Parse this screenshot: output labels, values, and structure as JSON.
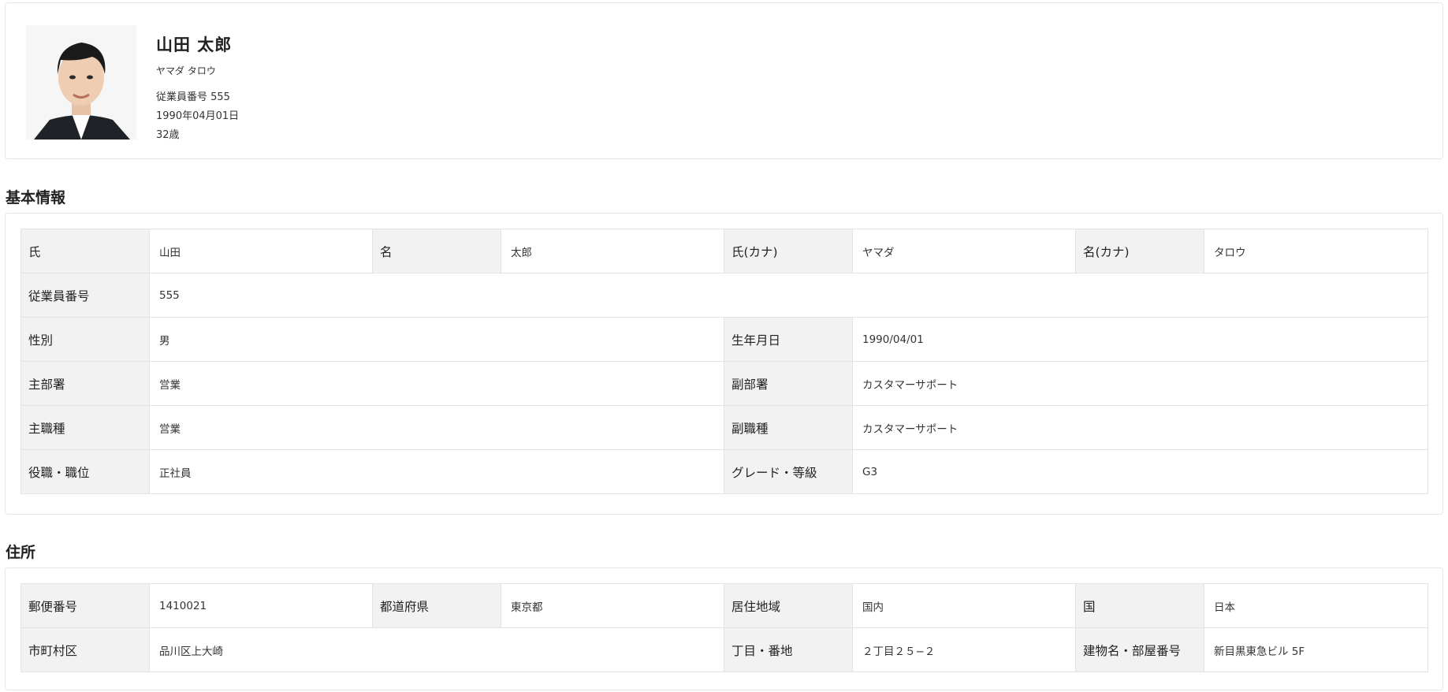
{
  "profile": {
    "name": "山田 太郎",
    "kana": "ヤマダ タロウ",
    "employee_no": "従業員番号 555",
    "birthday": "1990年04月01日",
    "age": "32歳",
    "photo_icon": "employee-photo"
  },
  "basic": {
    "title": "基本情報",
    "last_name_label": "氏",
    "last_name": "山田",
    "first_name_label": "名",
    "first_name": "太郎",
    "last_kana_label": "氏(カナ)",
    "last_kana": "ヤマダ",
    "first_kana_label": "名(カナ)",
    "first_kana": "タロウ",
    "emp_no_label": "従業員番号",
    "emp_no": "555",
    "gender_label": "性別",
    "gender": "男",
    "birth_label": "生年月日",
    "birth": "1990/04/01",
    "main_dept_label": "主部署",
    "main_dept": "営業",
    "sub_dept_label": "副部署",
    "sub_dept": "カスタマーサポート",
    "main_job_label": "主職種",
    "main_job": "営業",
    "sub_job_label": "副職種",
    "sub_job": "カスタマーサポート",
    "position_label": "役職・職位",
    "position": "正社員",
    "grade_label": "グレード・等級",
    "grade": "G3"
  },
  "address": {
    "title": "住所",
    "zip_label": "郵便番号",
    "zip": "1410021",
    "pref_label": "都道府県",
    "pref": "東京都",
    "region_label": "居住地域",
    "region": "国内",
    "country_label": "国",
    "country": "日本",
    "city_label": "市町村区",
    "city": "品川区上大崎",
    "street_label": "丁目・番地",
    "street": "２丁目２５−２",
    "building_label": "建物名・部屋番号",
    "building": "新目黒東急ビル 5F"
  }
}
